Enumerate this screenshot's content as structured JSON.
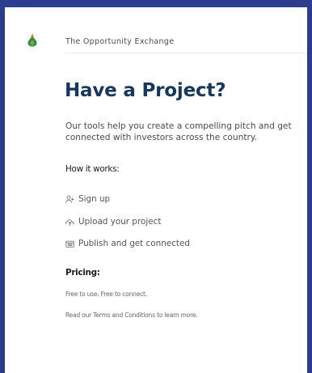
{
  "brand": {
    "name": "The Opportunity Exchange",
    "logo_icon": "flame-drop-icon"
  },
  "hero": {
    "title": "Have a Project?",
    "intro": "Our tools help you create a compelling pitch and get connected with investors across the country."
  },
  "how_it_works": {
    "heading": "How it works:",
    "steps": [
      {
        "icon": "add-user-icon",
        "label": "Sign up"
      },
      {
        "icon": "upload-icon",
        "label": "Upload your project"
      },
      {
        "icon": "publish-icon",
        "label": "Publish and get connected"
      }
    ]
  },
  "pricing": {
    "heading": "Pricing:",
    "text": "Free to use. Free to connect.",
    "terms": "Read our Terms and Conditions to learn more."
  },
  "colors": {
    "frame": "#2c3d8f",
    "title": "#17375d",
    "logo_green": "#3b8a3a",
    "logo_orange": "#e8862a"
  }
}
